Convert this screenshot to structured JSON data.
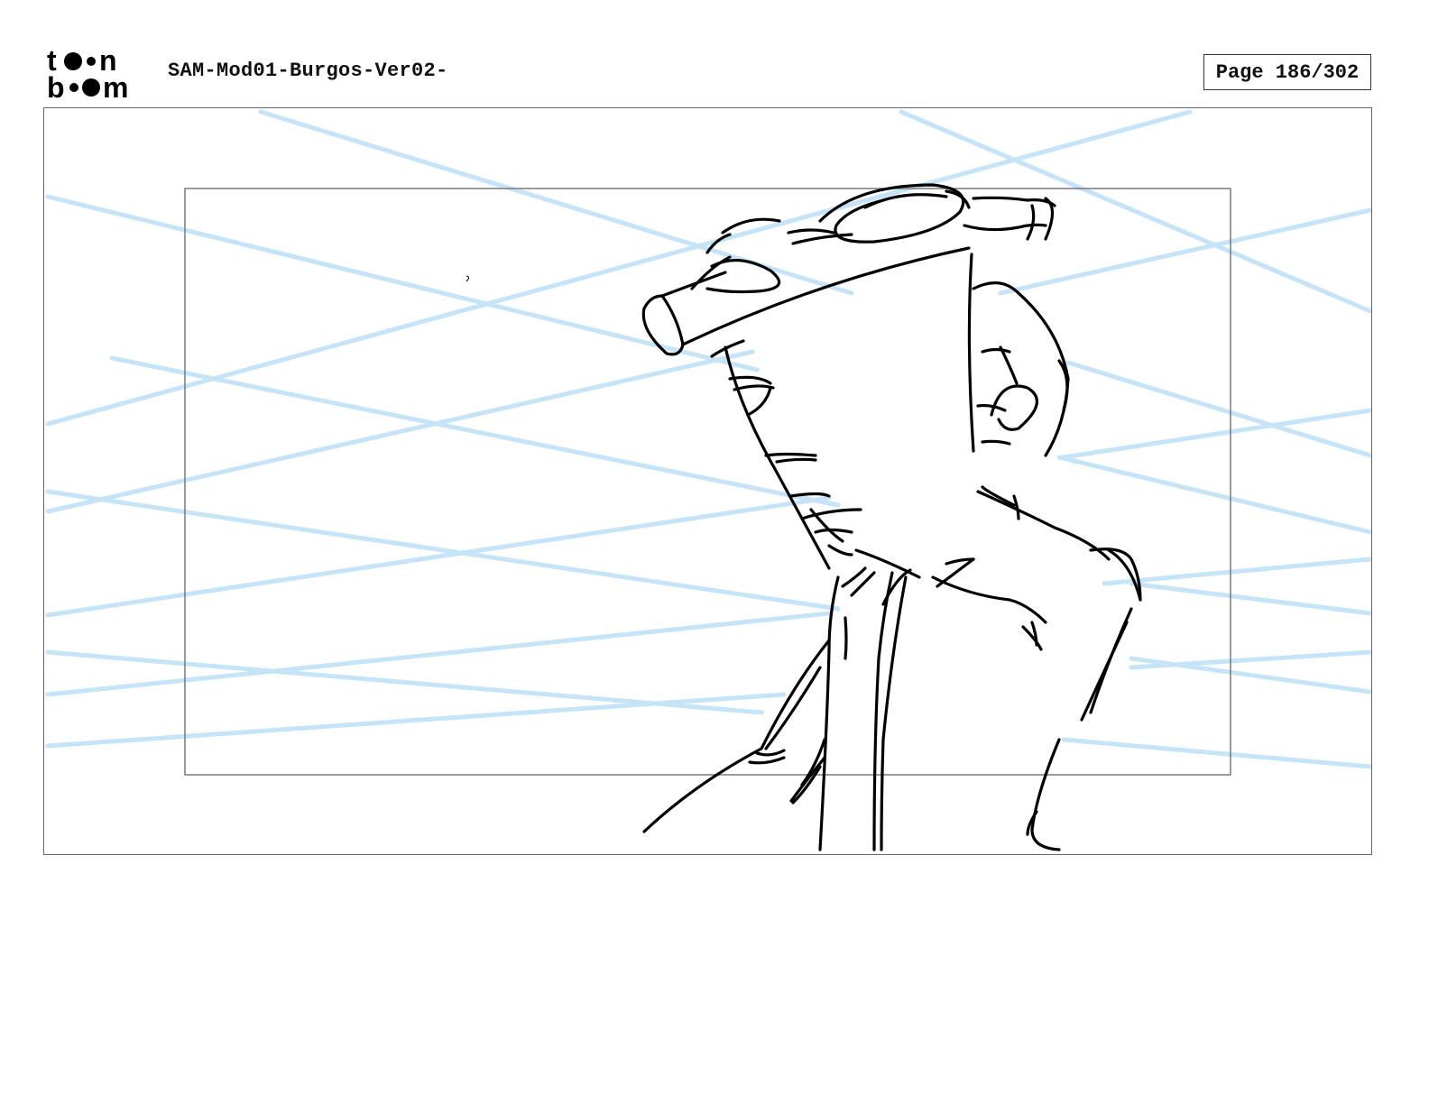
{
  "header": {
    "logo_text_top": "toon",
    "logo_text_bottom": "boom",
    "document_title": "SAM-Mod01-Burgos-Ver02-",
    "page_counter": "Page 186/302"
  },
  "colors": {
    "sketch_line": "#000000",
    "guide_line": "#c6e4f7",
    "frame_border": "#666666",
    "safe_area_border": "#7a7a7a"
  },
  "panel": {
    "content": "storyboard-sketch",
    "icon": "character-sketch"
  }
}
